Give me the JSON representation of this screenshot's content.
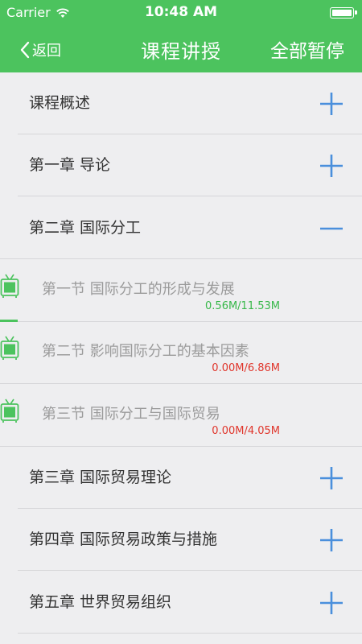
{
  "status_bar": {
    "carrier": "Carrier",
    "time": "10:48 AM"
  },
  "nav": {
    "back_label": "返回",
    "title": "课程讲授",
    "pause_all_label": "全部暂停"
  },
  "colors": {
    "accent": "#4cc35e",
    "icon_blue": "#4a8fdc",
    "progress_green": "#38b84a",
    "progress_red": "#e0352b"
  },
  "chapters_top": [
    {
      "label": "课程概述",
      "icon": "plus-icon"
    },
    {
      "label": "第一章 导论",
      "icon": "plus-icon"
    },
    {
      "label": "第二章 国际分工",
      "icon": "minus-icon"
    }
  ],
  "sections": [
    {
      "label": "第一节 国际分工的形成与发展",
      "progress": "0.56M/11.53M",
      "progress_fraction": 0.049,
      "status": "downloading"
    },
    {
      "label": "第二节 影响国际分工的基本因素",
      "progress": "0.00M/6.86M",
      "progress_fraction": 0.0,
      "status": "paused"
    },
    {
      "label": "第三节 国际分工与国际贸易",
      "progress": "0.00M/4.05M",
      "progress_fraction": 0.0,
      "status": "paused"
    }
  ],
  "chapters_bottom": [
    {
      "label": "第三章 国际贸易理论",
      "icon": "plus-icon"
    },
    {
      "label": "第四章 国际贸易政策与措施",
      "icon": "plus-icon"
    },
    {
      "label": "第五章 世界贸易组织",
      "icon": "plus-icon"
    }
  ]
}
